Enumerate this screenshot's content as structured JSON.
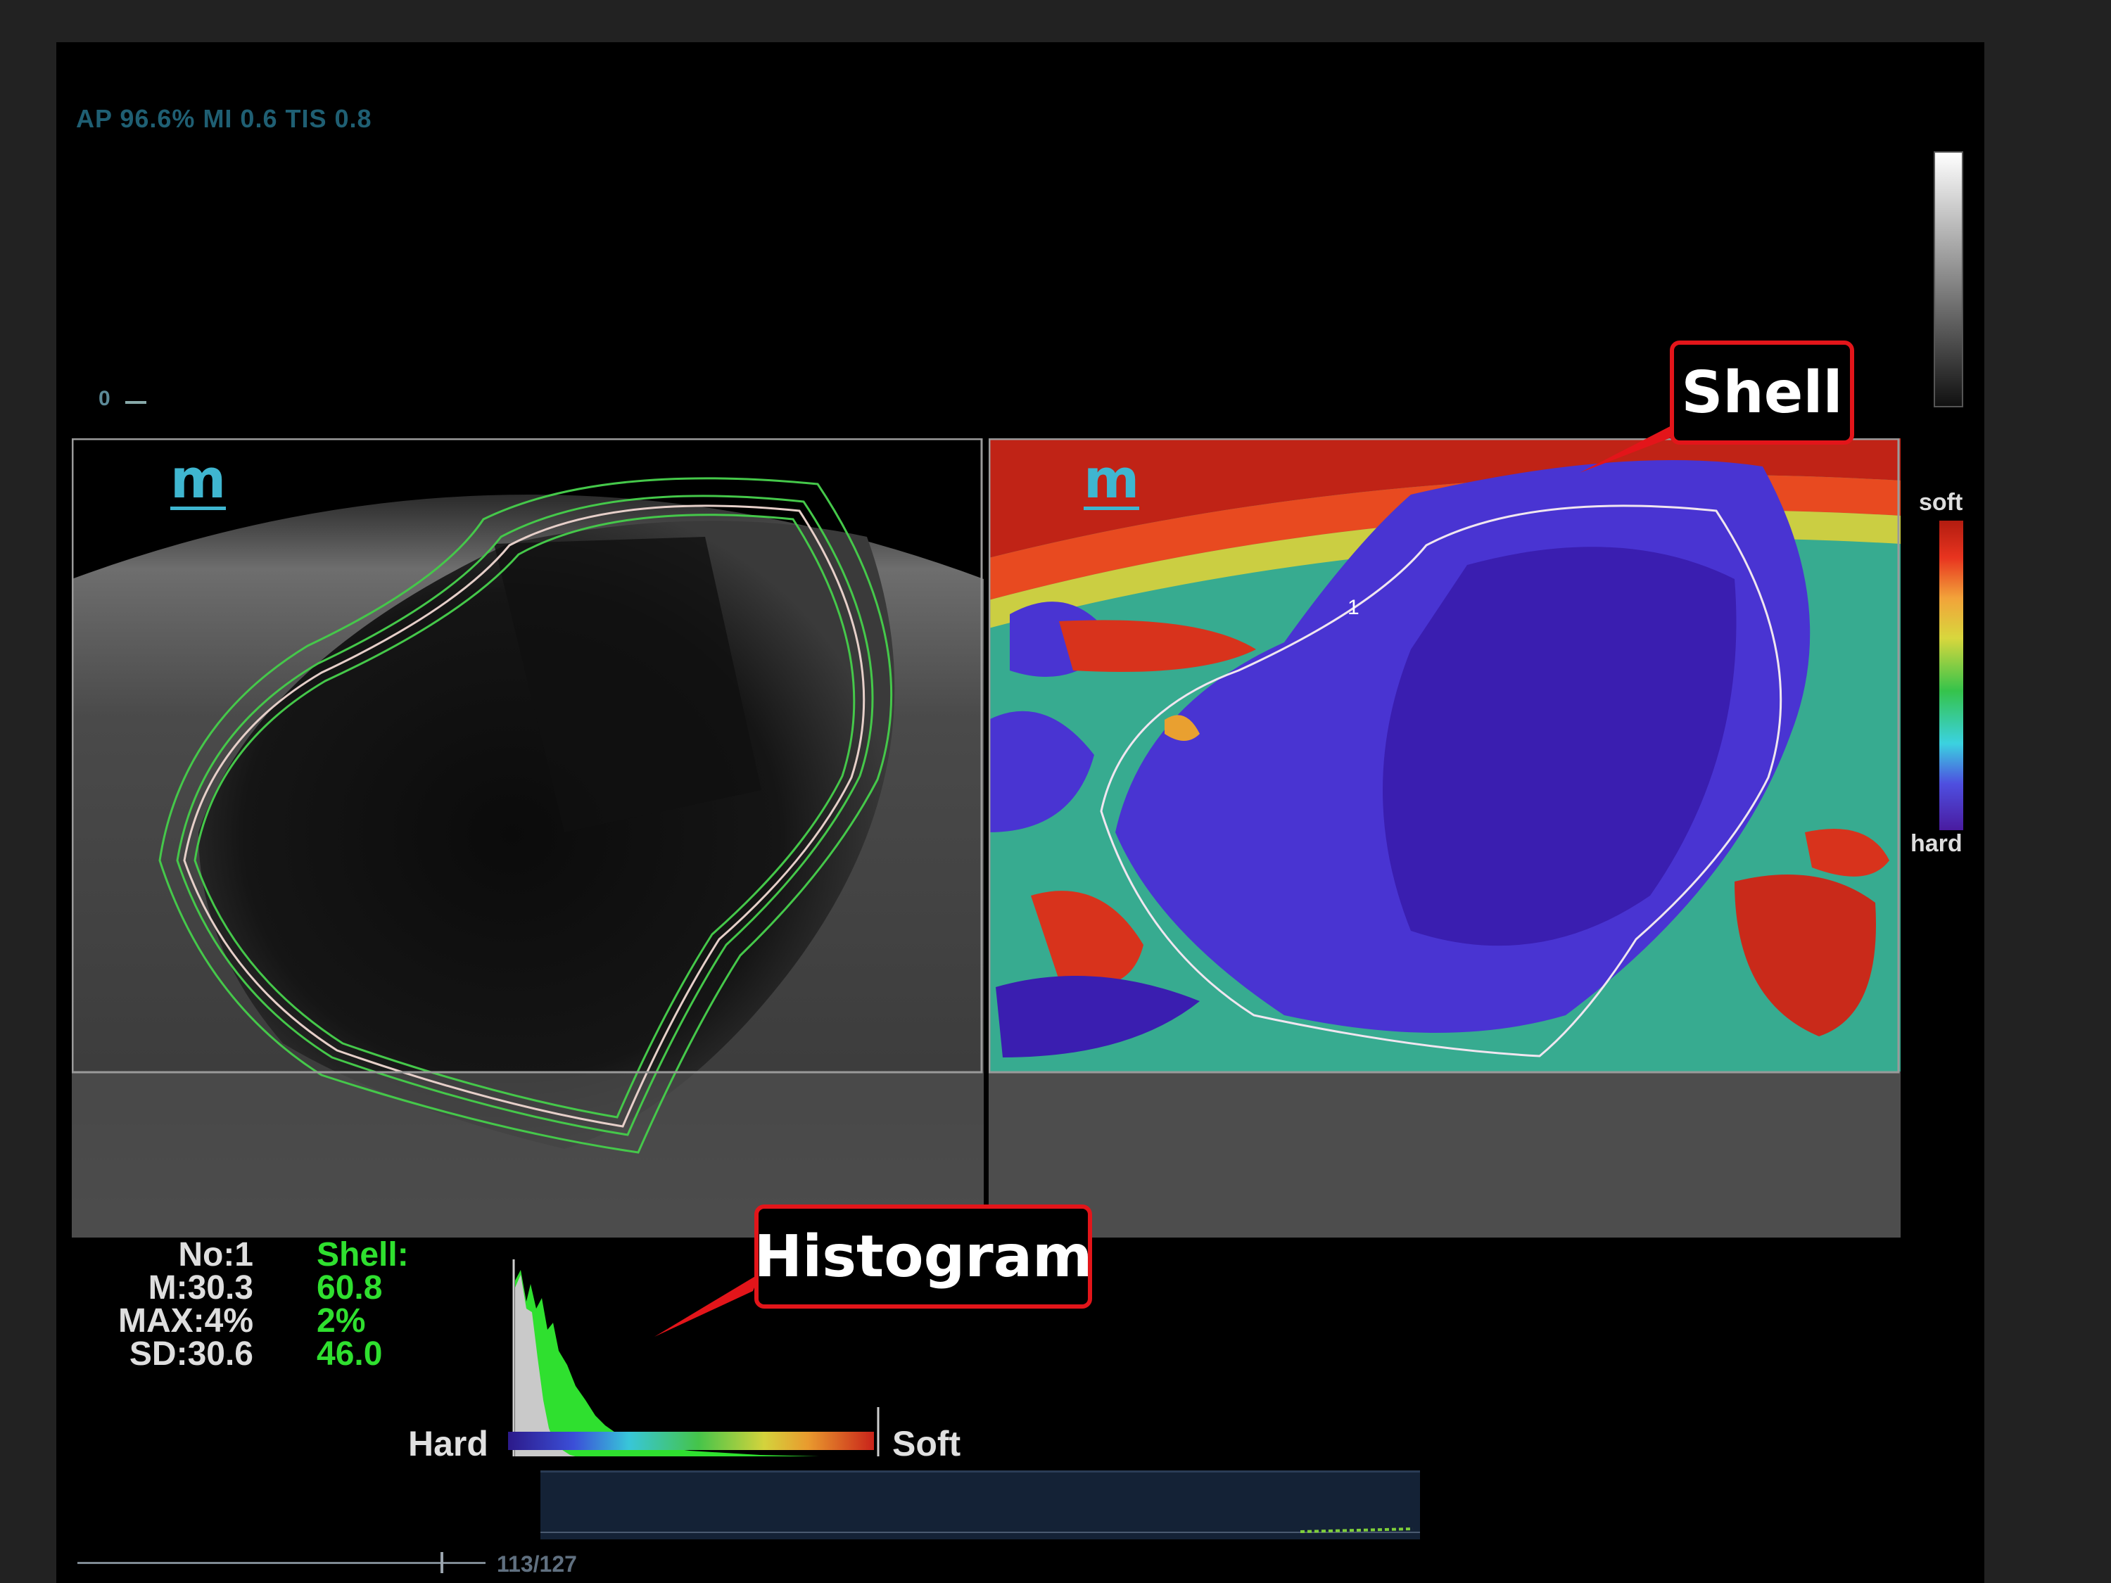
{
  "header": {
    "params": "AP 96.6%  MI 0.6 TIS 0.8"
  },
  "depth_marker": "0",
  "panels": {
    "bmode_logo": "m",
    "elasto_logo": "m",
    "roi_marker": "1"
  },
  "color_bar": {
    "top_label": "soft",
    "bottom_label": "hard"
  },
  "callouts": {
    "shell": "Shell",
    "histogram": "Histogram"
  },
  "stats": {
    "white": "No:1\n  M:30.3\nMAX:4%\n  SD:30.6",
    "green": "Shell:\n60.8\n2%\n46.0"
  },
  "histogram": {
    "hard_label": "Hard",
    "soft_label": "Soft"
  },
  "cine": {
    "frame": "113/127",
    "position": 0.89
  },
  "colors": {
    "accent_green": "#2fe02f",
    "callout_red": "#e3151a",
    "screen_bg": "#000000",
    "page_bg": "#222222"
  }
}
